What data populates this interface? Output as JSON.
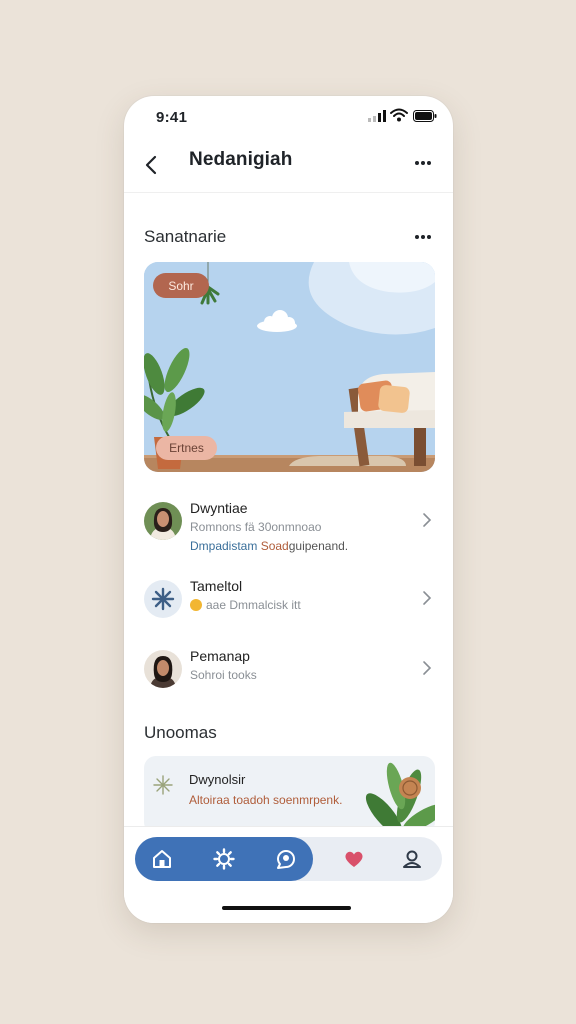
{
  "status_bar": {
    "time": "9:41"
  },
  "nav": {
    "title": "Nedanigiah",
    "back_icon": "chevron-left-icon",
    "more_icon": "more-horizontal-icon"
  },
  "section1": {
    "title": "Sanatnarie"
  },
  "hero": {
    "top_badge": "Sohr",
    "bottom_badge": "Ertnes"
  },
  "list": [
    {
      "title": "Dwyntiae",
      "subtitle": "Romnons fä 30onmnoao",
      "detail_1": "Dmpadistam",
      "detail_2": "Soad",
      "detail_3": "guipenand."
    },
    {
      "title": "Tameltol",
      "subtitle": "aae Dmmalcisk itt",
      "icon": "starburst-icon"
    },
    {
      "title": "Pemanap",
      "subtitle": "Sohroi tooks"
    }
  ],
  "section2": {
    "title": "Unoomas"
  },
  "card": {
    "title": "Dwynolsir",
    "subtitle": "Altoiraa toadoh soenmrpenk.",
    "icon": "sparkle-icon"
  },
  "tabs": [
    {
      "name": "home",
      "icon": "home-icon"
    },
    {
      "name": "explore",
      "icon": "gear-icon"
    },
    {
      "name": "activity",
      "icon": "chat-bubble-icon"
    },
    {
      "name": "favorites",
      "icon": "heart-icon"
    },
    {
      "name": "profile",
      "icon": "person-icon"
    }
  ],
  "colors": {
    "accent": "#3f72b7",
    "badge": "#b2664f",
    "heart": "#d9506a",
    "background": "#ebe3d9"
  }
}
